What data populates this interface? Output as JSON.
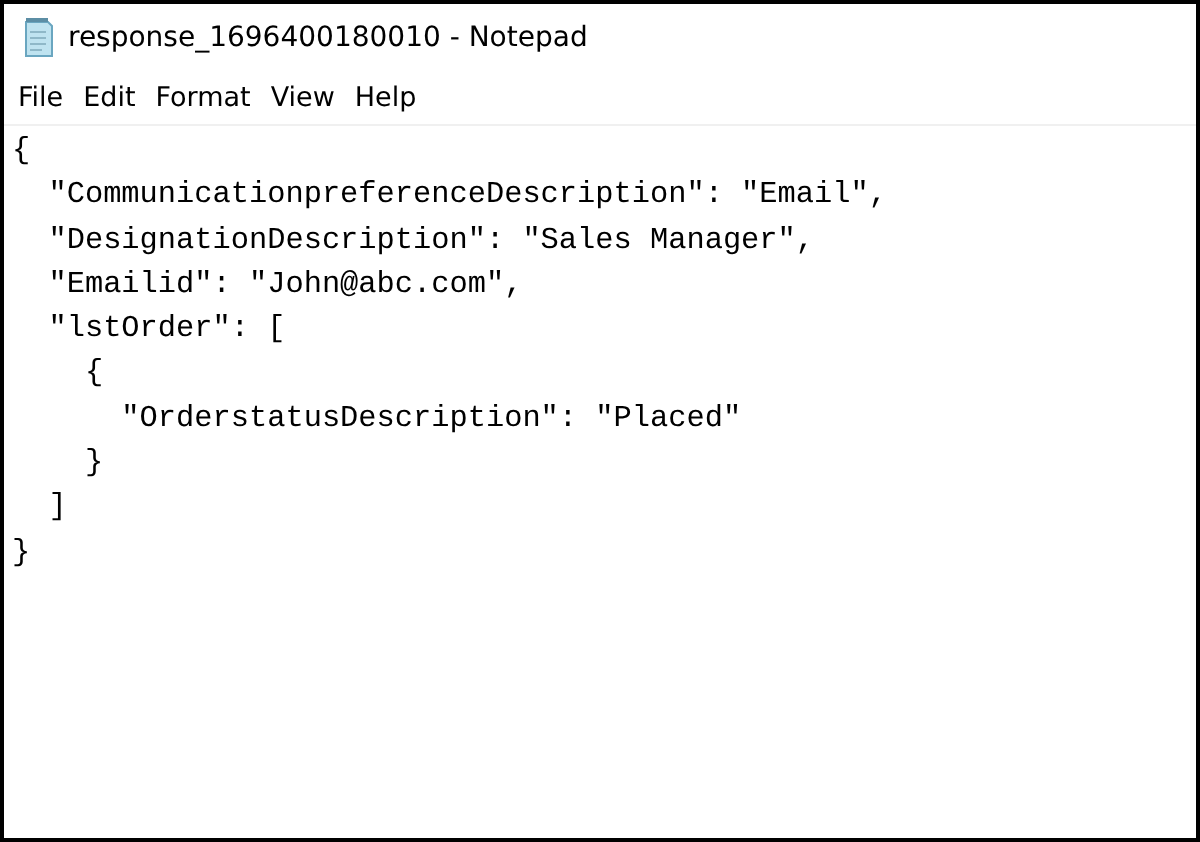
{
  "window": {
    "title": "response_1696400180010 - Notepad"
  },
  "menu": [
    "File",
    "Edit",
    "Format",
    "View",
    "Help"
  ],
  "document": {
    "lines": [
      "{",
      "  \"CommunicationpreferenceDescription\": \"Email\",",
      "  \"DesignationDescription\": \"Sales Manager\",",
      "  \"Emailid\": \"John@abc.com\",",
      "  \"lstOrder\": [",
      "    {",
      "      \"OrderstatusDescription\": \"Placed\"",
      "    }",
      "  ]",
      "}"
    ]
  }
}
